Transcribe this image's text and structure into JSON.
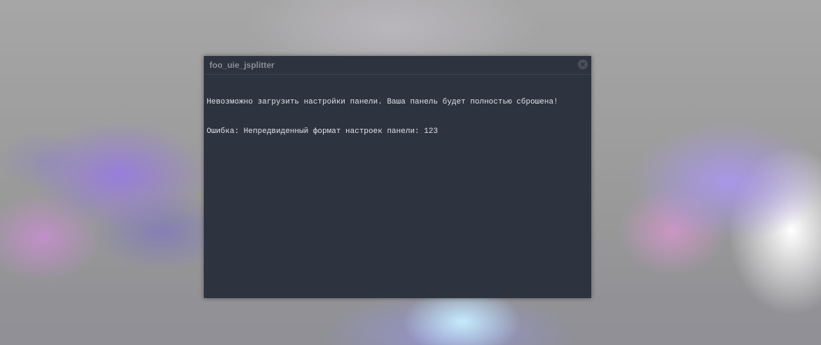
{
  "dialog": {
    "title": "foo_uie_jsplitter",
    "close_icon": "close-icon",
    "lines": [
      "Невозможно загрузить настройки панели. Ваша панель будет полностью сброшена!",
      "Ошибка: Непредвиденный формат настроек панели: 123"
    ]
  },
  "colors": {
    "dialog_background": "#2d333f",
    "title_text": "#8c8f96",
    "message_text": "#dfe2e8"
  }
}
